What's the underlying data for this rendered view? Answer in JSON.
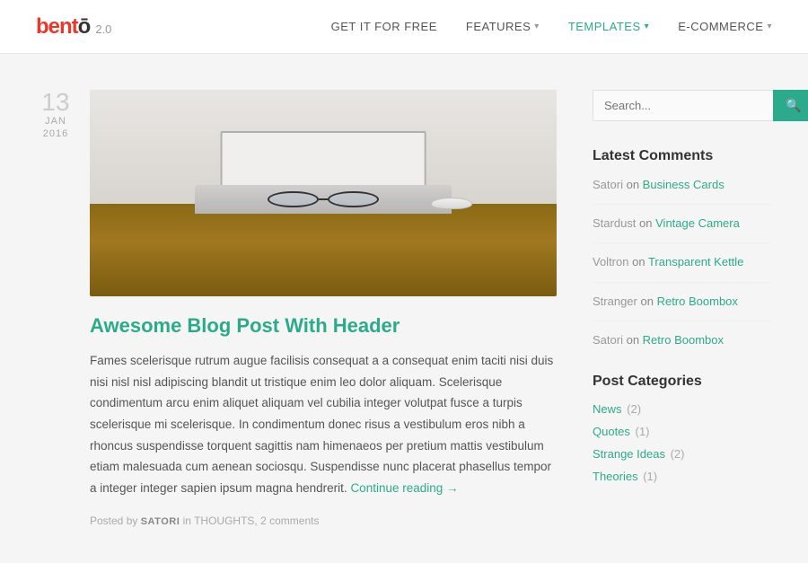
{
  "header": {
    "logo_text": "bentō",
    "logo_version": "2.0",
    "nav": [
      {
        "id": "get-it-free",
        "label": "GET IT FOR FREE",
        "active": false,
        "has_chevron": false
      },
      {
        "id": "features",
        "label": "FEATURES",
        "active": false,
        "has_chevron": true
      },
      {
        "id": "templates",
        "label": "TEMPLATES",
        "active": true,
        "has_chevron": true
      },
      {
        "id": "ecommerce",
        "label": "E-COMMERCE",
        "active": false,
        "has_chevron": true
      }
    ]
  },
  "article": {
    "date": {
      "day": "13",
      "month": "JAN",
      "year": "2016"
    },
    "title": "Awesome Blog Post With Header",
    "body": "Fames scelerisque rutrum augue facilisis consequat a a consequat enim taciti nisi duis nisi nisl nisl adipiscing blandit ut tristique enim leo dolor aliquam. Scelerisque condimentum arcu enim aliquet aliquam vel cubilia integer volutpat fusce a turpis scelerisque mi scelerisque. In condimentum donec risus a vestibulum eros nibh a rhoncus suspendisse torquent sagittis nam himenaeos per pretium mattis vestibulum etiam malesuada cum aenean sociosqu. Suspendisse nunc placerat phasellus tempor a integer integer sapien ipsum magna hendrerit.",
    "continue_label": "Continue reading →",
    "meta_posted": "Posted by",
    "meta_author": "SATORI",
    "meta_in": "in",
    "meta_category": "THOUGHTS",
    "meta_comments": "2 comments"
  },
  "sidebar": {
    "search_placeholder": "Search...",
    "latest_comments_title": "Latest Comments",
    "comments": [
      {
        "author": "Satori",
        "on": "on",
        "link_text": "Business Cards"
      },
      {
        "author": "Stardust",
        "on": "on",
        "link_text": "Vintage Camera"
      },
      {
        "author": "Voltron",
        "on": "on",
        "link_text": "Transparent Kettle"
      },
      {
        "author": "Stranger",
        "on": "on",
        "link_text": "Retro Boombox"
      },
      {
        "author": "Satori",
        "on": "on",
        "link_text": "Retro Boombox"
      }
    ],
    "categories_title": "Post Categories",
    "categories": [
      {
        "label": "News",
        "count": "(2)"
      },
      {
        "label": "Quotes",
        "count": "(1)"
      },
      {
        "label": "Strange Ideas",
        "count": "(2)"
      },
      {
        "label": "Theories",
        "count": "(1)"
      }
    ]
  },
  "colors": {
    "accent": "#2bab8b",
    "logo_red": "#e8392b"
  }
}
